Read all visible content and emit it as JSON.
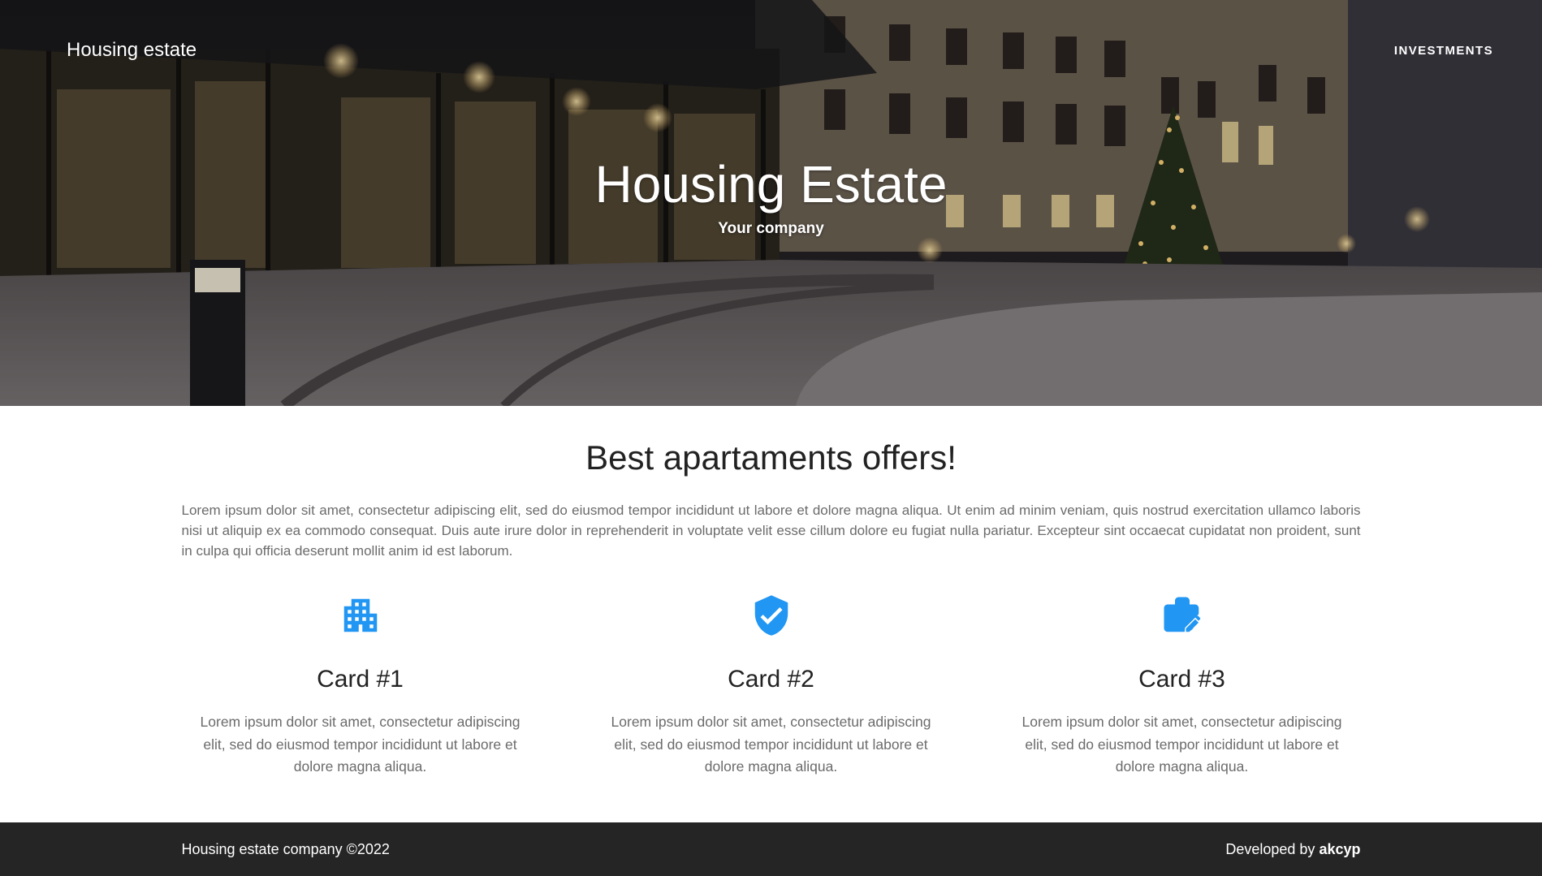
{
  "navbar": {
    "brand": "Housing estate",
    "links": [
      {
        "label": "INVESTMENTS"
      }
    ]
  },
  "hero": {
    "title": "Housing Estate",
    "subtitle": "Your company"
  },
  "offers": {
    "title": "Best apartaments offers!",
    "intro": "Lorem ipsum dolor sit amet, consectetur adipiscing elit, sed do eiusmod tempor incididunt ut labore et dolore magna aliqua. Ut enim ad minim veniam, quis nostrud exercitation ullamco laboris nisi ut aliquip ex ea commodo consequat. Duis aute irure dolor in reprehenderit in voluptate velit esse cillum dolore eu fugiat nulla pariatur. Excepteur sint occaecat cupidatat non proident, sunt in culpa qui officia deserunt mollit anim id est laborum."
  },
  "cards": [
    {
      "icon": "apartment-building-icon",
      "title": "Card #1",
      "text": "Lorem ipsum dolor sit amet, consectetur adipiscing elit, sed do eiusmod tempor incididunt ut labore et dolore magna aliqua."
    },
    {
      "icon": "verified-shield-icon",
      "title": "Card #2",
      "text": "Lorem ipsum dolor sit amet, consectetur adipiscing elit, sed do eiusmod tempor incididunt ut labore et dolore magna aliqua."
    },
    {
      "icon": "work-briefcase-edit-icon",
      "title": "Card #3",
      "text": "Lorem ipsum dolor sit amet, consectetur adipiscing elit, sed do eiusmod tempor incididunt ut labore et dolore magna aliqua."
    }
  ],
  "colors": {
    "accent": "#2196f3",
    "footer_bg": "#252525"
  },
  "footer": {
    "copyright": "Housing estate company ©2022",
    "developed_prefix": "Developed by",
    "developer": "akcyp"
  }
}
